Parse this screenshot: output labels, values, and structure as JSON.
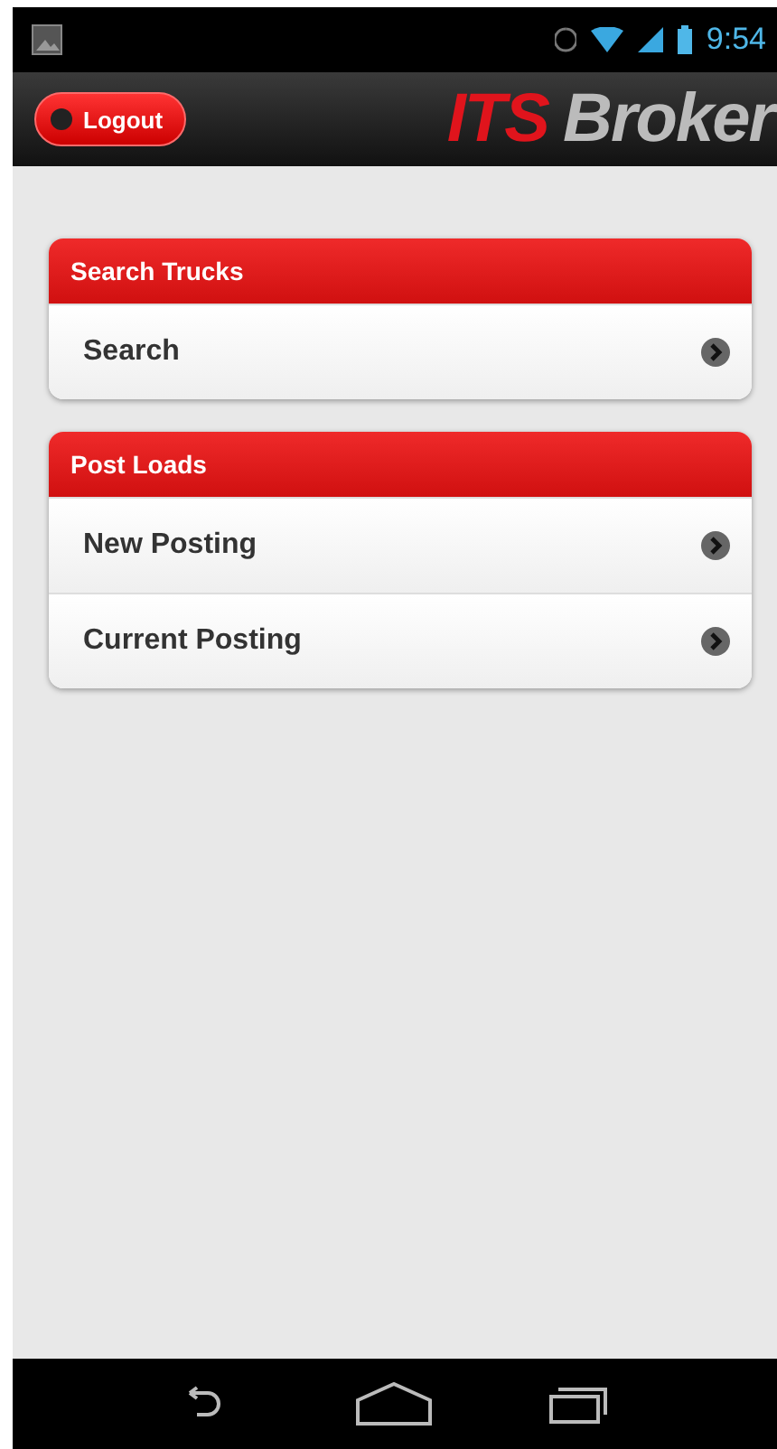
{
  "status_bar": {
    "time": "9:54"
  },
  "header": {
    "logout": "Logout",
    "logo": {
      "part_1": "ITS",
      "part_2": "Broker"
    }
  },
  "sections": [
    {
      "title": "Search Trucks",
      "items": [
        {
          "label": "Search"
        }
      ]
    },
    {
      "title": "Post Loads",
      "items": [
        {
          "label": "New Posting"
        },
        {
          "label": "Current Posting"
        }
      ]
    }
  ]
}
